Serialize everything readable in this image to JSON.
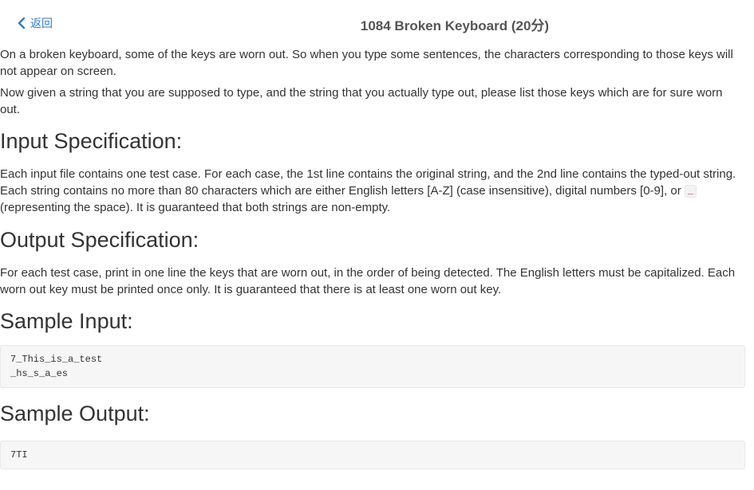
{
  "header": {
    "back_label": "返回",
    "title": "1084 Broken Keyboard (20分)"
  },
  "problem": {
    "description": [
      "On a broken keyboard, some of the keys are worn out. So when you type some sentences, the characters corresponding to those keys will not appear on screen.",
      "Now given a string that you are supposed to type, and the string that you actually type out, please list those keys which are for sure worn out."
    ],
    "input_spec": {
      "heading": "Input Specification:",
      "text_before": "Each input file contains one test case. For each case, the 1st line contains the original string, and the 2nd line contains the typed-out string. Each string contains no more than 80 characters which are either English letters [A-Z] (case insensitive), digital numbers [0-9], or ",
      "code": "_",
      "text_after": " (representing the space). It is guaranteed that both strings are non-empty."
    },
    "output_spec": {
      "heading": "Output Specification:",
      "text": "For each test case, print in one line the keys that are worn out, in the order of being detected. The English letters must be capitalized. Each worn out key must be printed once only. It is guaranteed that there is at least one worn out key."
    },
    "sample_input": {
      "heading": "Sample Input:",
      "code": "7_This_is_a_test\n_hs_s_a_es"
    },
    "sample_output": {
      "heading": "Sample Output:",
      "code": "7TI"
    }
  },
  "colors": {
    "link": "#2f7ccc",
    "title": "#555555",
    "text": "#333333",
    "code_bg": "#f6f6f6",
    "inline_code": "#c7254e"
  },
  "icons": {
    "back": "chevron-left-icon"
  }
}
